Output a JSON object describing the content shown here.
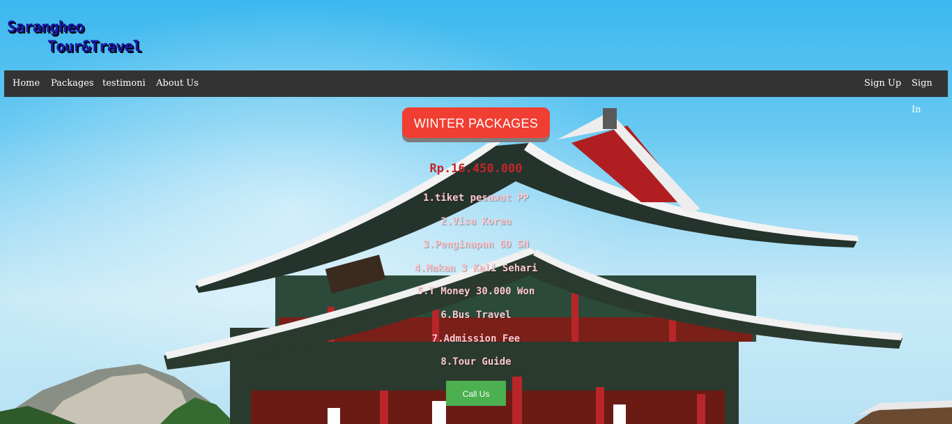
{
  "brand": {
    "line1": "Sarangheo",
    "line2": "Tour&Travel"
  },
  "nav": {
    "left": [
      "Home",
      "Packages",
      "testimoni",
      "About Us"
    ],
    "right": [
      "Sign Up",
      "Sign In"
    ]
  },
  "hero": {
    "package_button": "WINTER PACKAGES",
    "price": "Rp.16.450.000",
    "features": [
      "1.tiket pesawat PP",
      "2.Visa Korea",
      "3.Penginapan 6D 5N",
      "4.Makan 3 Kali Sehari",
      "5.T Money 30.000 Won",
      "6.Bus Travel",
      "7.Admission Fee",
      "8.Tour Guide"
    ],
    "call_button": "Call Us"
  },
  "colors": {
    "sky": "#3cb8ef",
    "navbar": "#333333",
    "package_button": "#f13e32",
    "call_button": "#4caf50",
    "price_text": "#c2262a",
    "brand_text": "#1a1aa6"
  }
}
